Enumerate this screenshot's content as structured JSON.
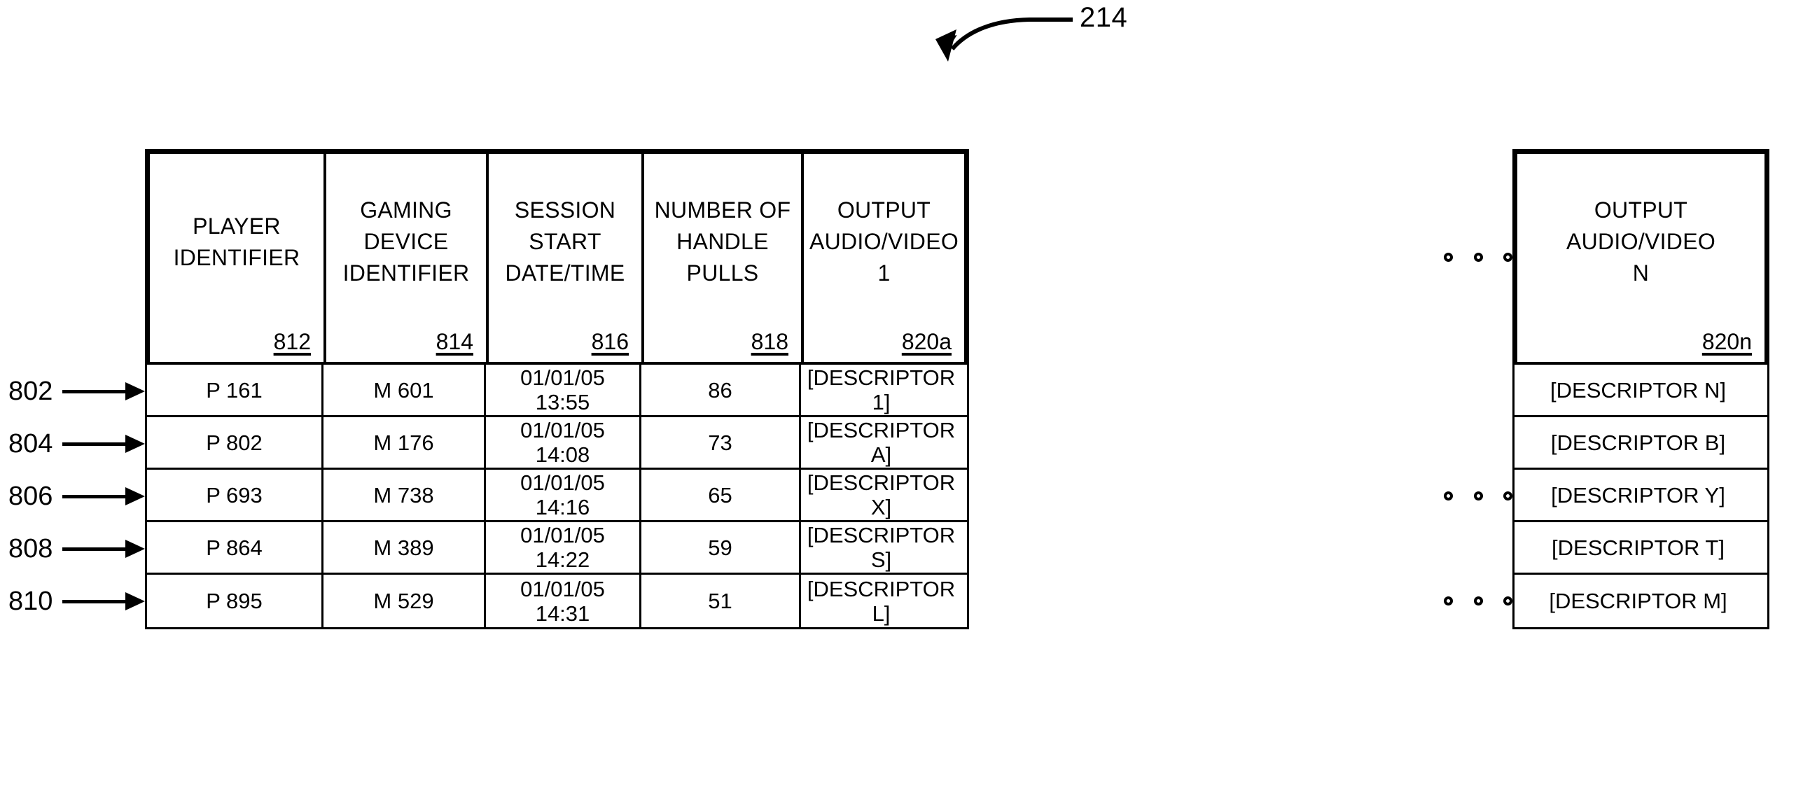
{
  "figure": {
    "reference_number": "214",
    "arrow_icon": "curved-arrow-down-left-icon"
  },
  "table": {
    "headers": [
      {
        "label": "PLAYER\nIDENTIFIER",
        "ref": "812"
      },
      {
        "label": "GAMING\nDEVICE\nIDENTIFIER",
        "ref": "814"
      },
      {
        "label": "SESSION\nSTART\nDATE/TIME",
        "ref": "816"
      },
      {
        "label": "NUMBER OF\nHANDLE\nPULLS",
        "ref": "818"
      },
      {
        "label": "OUTPUT\nAUDIO/VIDEO\n1",
        "ref": "820a"
      }
    ],
    "tail_header": {
      "label": "OUTPUT\nAUDIO/VIDEO\nN",
      "ref": "820n"
    },
    "ellipsis_glyph": "horizontal-ellipsis-icon",
    "rows": [
      {
        "ref": "802",
        "player_identifier": "P 161",
        "gaming_device_identifier": "M 601",
        "session_start": "01/01/05\n13:55",
        "handle_pulls": "86",
        "output_av_1": "[DESCRIPTOR 1]",
        "output_av_n": "[DESCRIPTOR N]",
        "show_ellipsis": false
      },
      {
        "ref": "804",
        "player_identifier": "P 802",
        "gaming_device_identifier": "M 176",
        "session_start": "01/01/05\n14:08",
        "handle_pulls": "73",
        "output_av_1": "[DESCRIPTOR A]",
        "output_av_n": "[DESCRIPTOR B]",
        "show_ellipsis": false
      },
      {
        "ref": "806",
        "player_identifier": "P 693",
        "gaming_device_identifier": "M 738",
        "session_start": "01/01/05\n14:16",
        "handle_pulls": "65",
        "output_av_1": "[DESCRIPTOR X]",
        "output_av_n": "[DESCRIPTOR Y]",
        "show_ellipsis": true
      },
      {
        "ref": "808",
        "player_identifier": "P 864",
        "gaming_device_identifier": "M 389",
        "session_start": "01/01/05\n14:22",
        "handle_pulls": "59",
        "output_av_1": "[DESCRIPTOR S]",
        "output_av_n": "[DESCRIPTOR T]",
        "show_ellipsis": false
      },
      {
        "ref": "810",
        "player_identifier": "P 895",
        "gaming_device_identifier": "M 529",
        "session_start": "01/01/05\n14:31",
        "handle_pulls": "51",
        "output_av_1": "[DESCRIPTOR L]",
        "output_av_n": "[DESCRIPTOR M]",
        "show_ellipsis": true
      }
    ]
  },
  "colors": {
    "ink": "#000000",
    "paper": "#ffffff"
  }
}
